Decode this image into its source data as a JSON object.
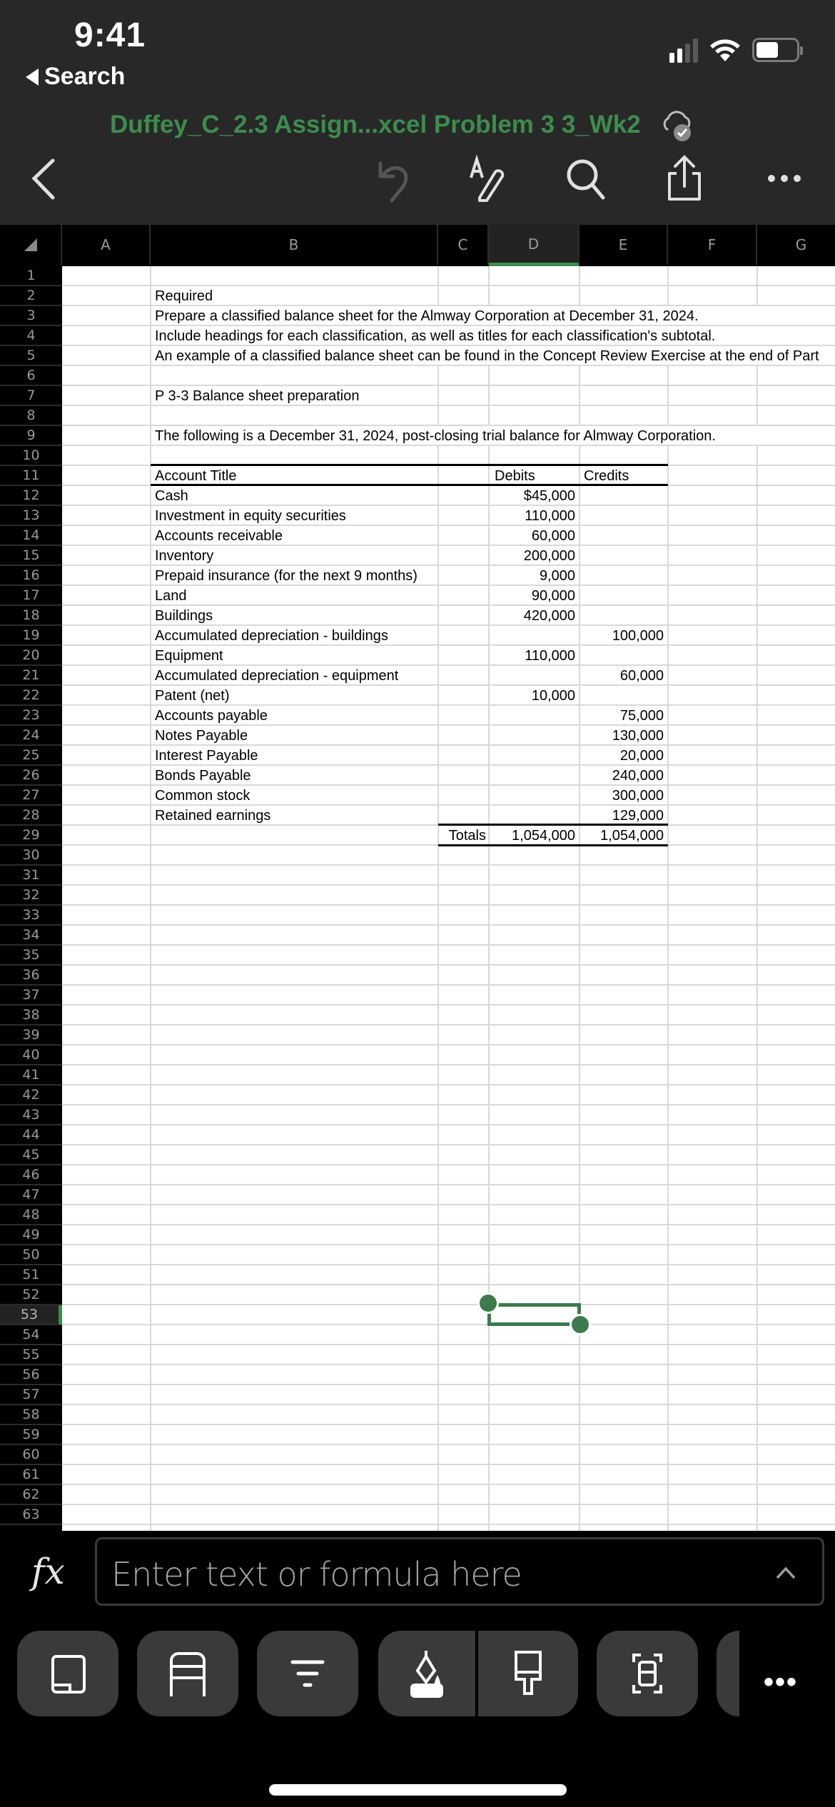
{
  "status_bar": {
    "time": "9:41",
    "back_app_label": "Search",
    "signal_bars_active": 2,
    "signal_bars_total": 4
  },
  "header": {
    "doc_title": "Duffey_C_2.3 Assign...xcel Problem 3 3_Wk2",
    "sync_status_icon": "cloud-check-icon",
    "accent_color": "#3d8c4d"
  },
  "top_toolbar": {
    "icons": [
      "back-chevron-icon",
      "undo-icon",
      "draw-pen-icon",
      "search-icon",
      "share-icon",
      "more-icon"
    ]
  },
  "sheet": {
    "columns": [
      "A",
      "B",
      "C",
      "D",
      "E",
      "F",
      "G"
    ],
    "selected_column": "D",
    "row_count_visible": 63,
    "selected_row": 53,
    "selected_cell": "D53",
    "instructions": [
      {
        "row": 2,
        "text": "Required"
      },
      {
        "row": 3,
        "text": "Prepare a classified balance sheet for the Almway Corporation at December 31, 2024."
      },
      {
        "row": 4,
        "text": "Include headings for each classification, as well as titles for each classification's subtotal."
      },
      {
        "row": 5,
        "text": "An example of a classified balance sheet can be found in the Concept Review Exercise at the end of Part"
      },
      {
        "row": 7,
        "text": "P 3-3 Balance sheet preparation"
      },
      {
        "row": 9,
        "text": "The following is a December 31, 2024, post-closing trial balance for Almway Corporation."
      }
    ],
    "trial_balance": {
      "header_row": 11,
      "headers": {
        "account": "Account Title",
        "debits": "Debits",
        "credits": "Credits"
      },
      "rows": [
        {
          "row": 12,
          "account": "Cash",
          "debit": "$45,000",
          "credit": ""
        },
        {
          "row": 13,
          "account": "Investment in equity securities",
          "debit": "110,000",
          "credit": ""
        },
        {
          "row": 14,
          "account": "Accounts receivable",
          "debit": "60,000",
          "credit": ""
        },
        {
          "row": 15,
          "account": "Inventory",
          "debit": "200,000",
          "credit": ""
        },
        {
          "row": 16,
          "account": "Prepaid insurance (for the next 9 months)",
          "debit": "9,000",
          "credit": ""
        },
        {
          "row": 17,
          "account": "Land",
          "debit": "90,000",
          "credit": ""
        },
        {
          "row": 18,
          "account": "Buildings",
          "debit": "420,000",
          "credit": ""
        },
        {
          "row": 19,
          "account": "Accumulated depreciation - buildings",
          "debit": "",
          "credit": "100,000"
        },
        {
          "row": 20,
          "account": "Equipment",
          "debit": "110,000",
          "credit": ""
        },
        {
          "row": 21,
          "account": "Accumulated depreciation - equipment",
          "debit": "",
          "credit": "60,000"
        },
        {
          "row": 22,
          "account": "Patent (net)",
          "debit": "10,000",
          "credit": ""
        },
        {
          "row": 23,
          "account": "Accounts payable",
          "debit": "",
          "credit": "75,000"
        },
        {
          "row": 24,
          "account": "Notes Payable",
          "debit": "",
          "credit": "130,000"
        },
        {
          "row": 25,
          "account": "Interest Payable",
          "debit": "",
          "credit": "20,000"
        },
        {
          "row": 26,
          "account": "Bonds Payable",
          "debit": "",
          "credit": "240,000"
        },
        {
          "row": 27,
          "account": "Common stock",
          "debit": "",
          "credit": "300,000"
        },
        {
          "row": 28,
          "account": "Retained earnings",
          "debit": "",
          "credit": "129,000"
        }
      ],
      "totals": {
        "row": 29,
        "label": "Totals",
        "debit": "1,054,000",
        "credit": "1,054,000"
      }
    }
  },
  "formula_bar": {
    "fx_label": "fx",
    "placeholder": "Enter text or formula here",
    "value": ""
  },
  "bottom_toolbar": {
    "buttons": [
      "sheet-view-icon",
      "table-icon",
      "filter-icon",
      "fill-color-icon",
      "format-painter-icon",
      "select-range-icon"
    ],
    "more_label": "•••"
  }
}
